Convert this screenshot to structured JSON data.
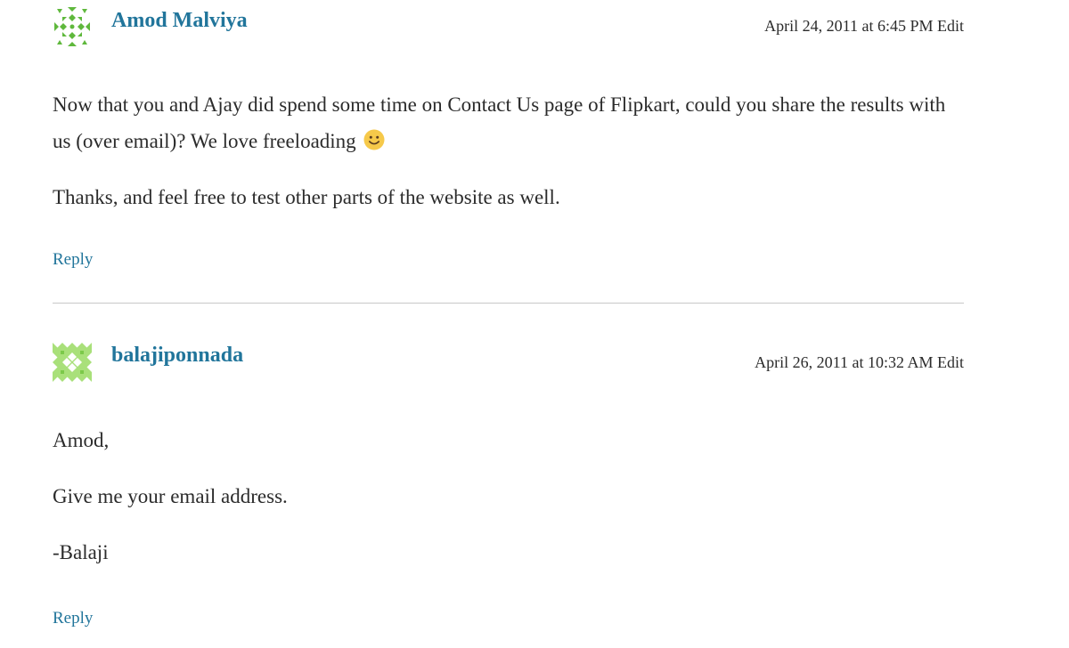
{
  "comments": [
    {
      "author": "Amod Malviya",
      "date": "April 24, 2011 at 6:45 PM",
      "edit_label": "Edit",
      "paragraphs": [
        "Now that you and Ajay did spend some time on Contact Us page of Flipkart, could you share the results with us (over email)? We love freeloading",
        "Thanks, and feel free to test other parts of the website as well."
      ],
      "emoji": "slightly-smiling-face-icon",
      "reply_label": "Reply",
      "avatar_color": "#5fb83c"
    },
    {
      "author": "balajiponnada",
      "date": "April 26, 2011 at 10:32 AM",
      "edit_label": "Edit",
      "paragraphs": [
        "Amod,",
        "Give me your email address.",
        "-Balaji"
      ],
      "reply_label": "Reply",
      "avatar_color": "#8fd45a"
    }
  ],
  "colors": {
    "link": "#21759b",
    "text": "#2b2b2b",
    "divider": "#c8c8c8"
  }
}
